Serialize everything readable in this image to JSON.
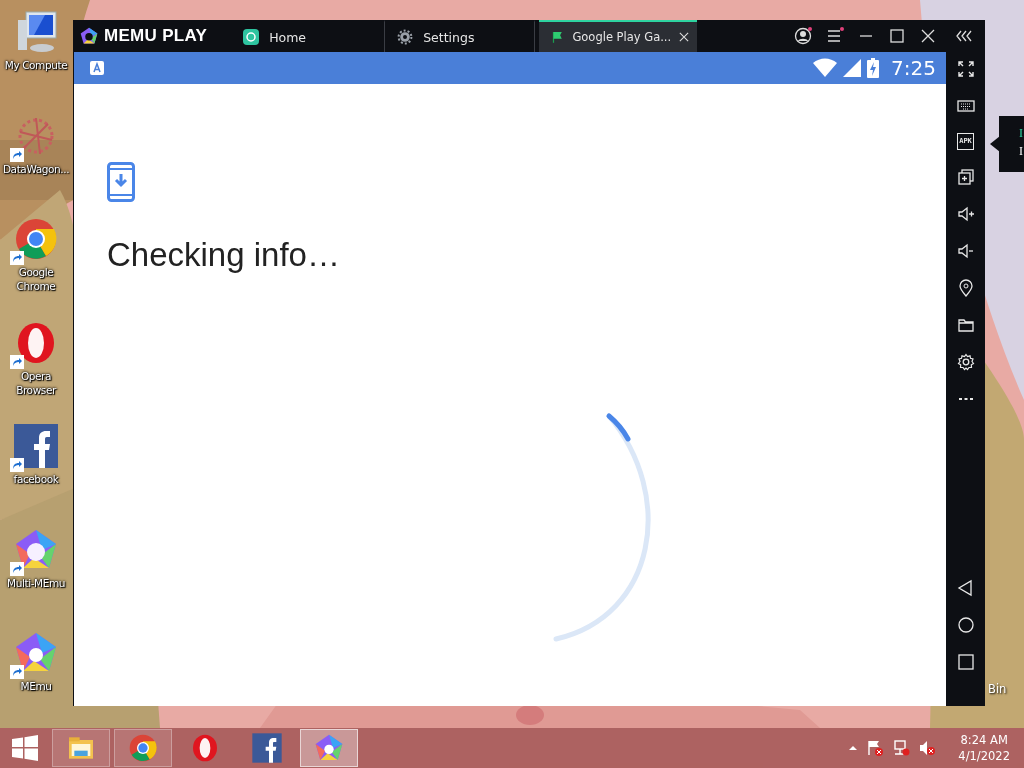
{
  "desktop": {
    "icons": [
      {
        "label": "My Compute",
        "kind": "computer",
        "shortcut": false
      },
      {
        "label": "DataWagon...",
        "kind": "datawagon",
        "shortcut": true
      },
      {
        "label": "Google Chrome",
        "kind": "chrome",
        "shortcut": true
      },
      {
        "label": "Opera Browser",
        "kind": "opera",
        "shortcut": true
      },
      {
        "label": "facebook",
        "kind": "facebook",
        "shortcut": true
      },
      {
        "label": "Multi-MEmu",
        "kind": "multimemu",
        "shortcut": true
      },
      {
        "label": "MEmu",
        "kind": "memu",
        "shortcut": true
      }
    ],
    "recycle_label": "Bin"
  },
  "emulator": {
    "brand": "MEMU PLAY",
    "tabs": [
      {
        "label": "Home",
        "kind": "home",
        "selected": false
      },
      {
        "label": "Settings",
        "kind": "settings",
        "selected": false
      },
      {
        "label": "Google Play Ga...",
        "kind": "play",
        "selected": true
      }
    ],
    "status_bar": {
      "time": "7:25"
    },
    "screen": {
      "title": "Checking info…"
    },
    "sidebar": {
      "tools": [
        {
          "kind": "fullscreen"
        },
        {
          "kind": "keyboard"
        },
        {
          "kind": "apk",
          "label": "APK"
        },
        {
          "kind": "multi"
        },
        {
          "kind": "volume-up"
        },
        {
          "kind": "volume-down"
        },
        {
          "kind": "location"
        },
        {
          "kind": "folder"
        },
        {
          "kind": "settings"
        },
        {
          "kind": "more"
        }
      ],
      "nav": [
        {
          "kind": "back"
        },
        {
          "kind": "home"
        },
        {
          "kind": "recents"
        }
      ]
    },
    "tooltip": {
      "lines": [
        "I",
        "I"
      ]
    }
  },
  "taskbar": {
    "apps": [
      {
        "kind": "explorer",
        "open": true,
        "selected": false
      },
      {
        "kind": "chrome",
        "open": true,
        "selected": false
      },
      {
        "kind": "opera",
        "open": false,
        "selected": false
      },
      {
        "kind": "facebook",
        "open": false,
        "selected": false
      },
      {
        "kind": "memu",
        "open": true,
        "selected": true
      }
    ],
    "clock": {
      "time": "8:24 AM",
      "date": "4/1/2022"
    }
  }
}
